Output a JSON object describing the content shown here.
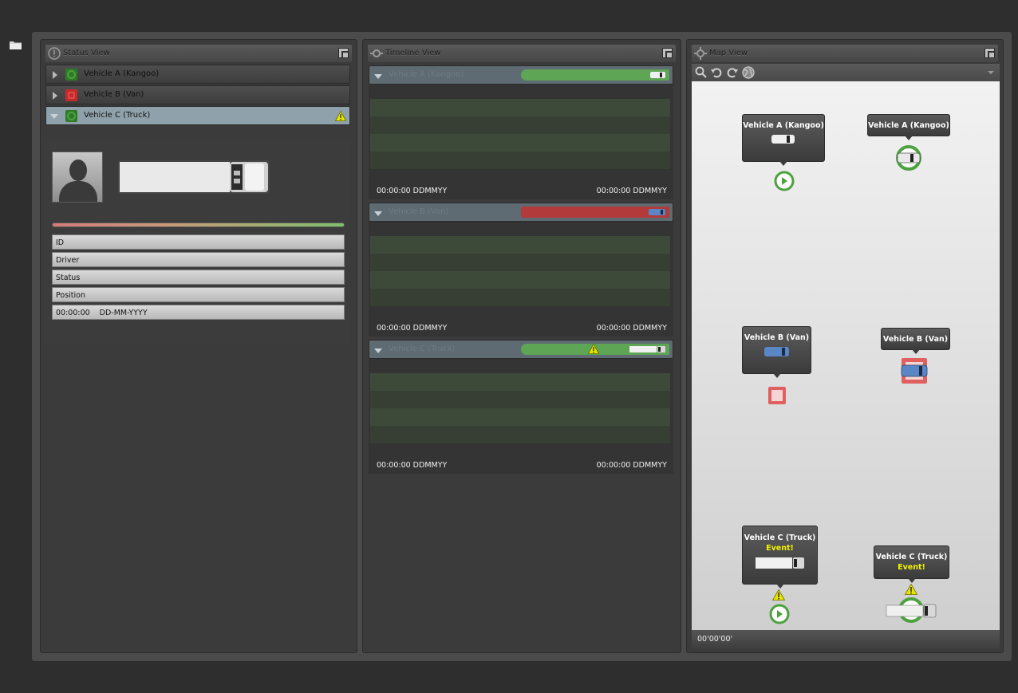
{
  "app": {
    "folder_icon": "folder-icon"
  },
  "status_view": {
    "title": "Status View",
    "vehicles": [
      {
        "label": "Vehicle A (Kangoo)",
        "status": "green",
        "expanded": false
      },
      {
        "label": "Vehicle B (Van)",
        "status": "red",
        "expanded": false
      },
      {
        "label": "Vehicle C (Truck)",
        "status": "green",
        "expanded": true,
        "warning": true
      }
    ],
    "detail": {
      "fields": [
        "ID",
        "Driver",
        "Status",
        "Position"
      ],
      "time": "00:00:00",
      "date": "DD-MM-YYYY"
    }
  },
  "timeline_view": {
    "title": "Timeline View",
    "tracks": [
      {
        "name": "Vehicle A (Kangoo)",
        "bar_color": "#5fa556",
        "start": "00:00:00 DDMMYY",
        "end": "00:00:00 DDMMYY"
      },
      {
        "name": "Vehicle B (Van)",
        "bar_color": "#b33a3a",
        "start": "00:00:00 DDMMYY",
        "end": "00:00:00 DDMMYY"
      },
      {
        "name": "Vehicle C (Truck)",
        "bar_color": "#5fa556",
        "start": "00:00:00 DDMMYY",
        "end": "00:00:00 DDMMYY",
        "warning": true
      }
    ]
  },
  "map_view": {
    "title": "Map View",
    "toolbar_icons": [
      "zoom-icon",
      "undo-icon",
      "redo-icon",
      "globe-icon",
      "dropdown-icon"
    ],
    "popups": [
      {
        "label": "Vehicle A (Kangoo)"
      },
      {
        "label": "Vehicle A (Kangoo)"
      },
      {
        "label": "Vehicle B (Van)"
      },
      {
        "label": "Vehicle B (Van)"
      },
      {
        "label": "Vehicle C (Truck)",
        "event": "Event!"
      },
      {
        "label": "Vehicle C (Truck)",
        "event": "Event!"
      }
    ],
    "status_time": "00'00'00'"
  },
  "colors": {
    "ok": "#5fa556",
    "alert": "#b33a3a",
    "event": "#f3f300",
    "selected": "#8fa2ab"
  }
}
